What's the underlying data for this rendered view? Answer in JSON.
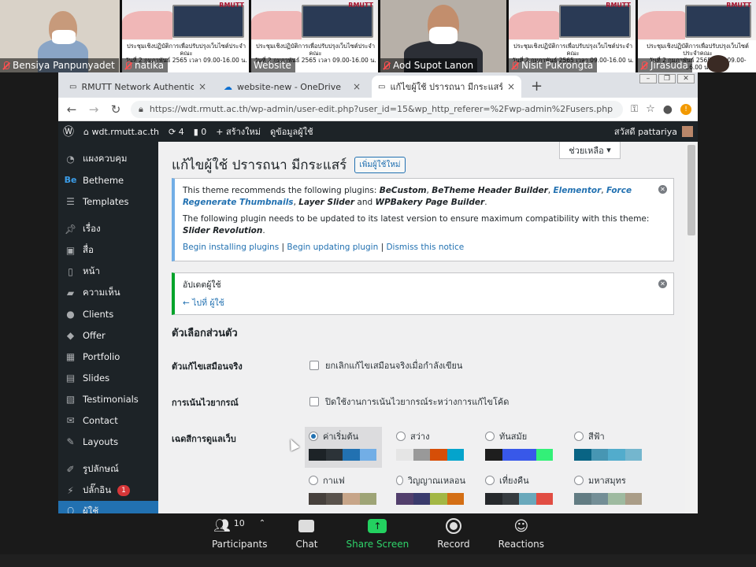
{
  "participants": [
    {
      "name": "Bensiya Panpunyadet",
      "muted": true
    },
    {
      "name": "natika",
      "muted": true
    },
    {
      "name": "Website",
      "muted": false
    },
    {
      "name": "Aod Supot Lanon",
      "muted": true
    },
    {
      "name": "Nisit Pukrongta",
      "muted": true
    },
    {
      "name": "Jirasuda",
      "muted": true
    }
  ],
  "slide": {
    "logo": "RMUTT",
    "caption_line1": "ประชุมเชิงปฏิบัติการเพื่อปรับปรุงเว็บไซต์ประจำคณะ",
    "caption_line2": "วันที่ 2 กุมภาพันธ์ 2565 เวลา 09.00-16.00 น."
  },
  "browser": {
    "tabs": [
      {
        "label": "RMUTT Network Authentication",
        "active": false
      },
      {
        "label": "website-new - OneDrive",
        "active": false
      },
      {
        "label": "แก้ไขผู้ใช้ ปรารถนา มีกระแสร์ ‹ wdt.",
        "active": true
      }
    ],
    "url": "https://wdt.rmutt.ac.th/wp-admin/user-edit.php?user_id=15&wp_http_referer=%2Fwp-admin%2Fusers.php"
  },
  "adminbar": {
    "site": "wdt.rmutt.ac.th",
    "updates": "4",
    "comments": "0",
    "new_label": "สร้างใหม่",
    "view_user": "ดูข้อมูลผู้ใช้",
    "howdy": "สวัสดี pattariya"
  },
  "sidebar": {
    "items": [
      {
        "label": "แผงควบคุม",
        "icon": "dashboard-icon"
      },
      {
        "label": "Betheme",
        "icon": "betheme-icon"
      },
      {
        "label": "Templates",
        "icon": "templates-icon"
      },
      {
        "label": "เรื่อง",
        "icon": "pin-icon"
      },
      {
        "label": "สื่อ",
        "icon": "media-icon"
      },
      {
        "label": "หน้า",
        "icon": "page-icon"
      },
      {
        "label": "ความเห็น",
        "icon": "comment-icon"
      },
      {
        "label": "Clients",
        "icon": "clients-icon"
      },
      {
        "label": "Offer",
        "icon": "offer-icon"
      },
      {
        "label": "Portfolio",
        "icon": "portfolio-icon"
      },
      {
        "label": "Slides",
        "icon": "slides-icon"
      },
      {
        "label": "Testimonials",
        "icon": "testimonials-icon"
      },
      {
        "label": "Contact",
        "icon": "contact-icon"
      },
      {
        "label": "Layouts",
        "icon": "layouts-icon"
      },
      {
        "label": "รูปลักษณ์",
        "icon": "appearance-icon"
      },
      {
        "label": "ปลั๊กอิน",
        "icon": "plugins-icon",
        "badge": "1"
      },
      {
        "label": "ผู้ใช้",
        "icon": "users-icon"
      }
    ]
  },
  "content": {
    "help": "ช่วยเหลือ",
    "title": "แก้ไขผู้ใช้ ปรารถนา มีกระแสร์",
    "add_new": "เพิ่มผู้ใช้ใหม่",
    "notice1": {
      "pre": "This theme recommends the following plugins: ",
      "p1": "BeCustom",
      "p2": "BeTheme Header Builder",
      "p3": "Elementor",
      "p4": "Force Regenerate Thumbnails",
      "p5": "Layer Slider",
      "and": " and ",
      "p6": "WPBakery Page Builder",
      "line2": "The following plugin needs to be updated to its latest version to ensure maximum compatibility with this theme: ",
      "p7": "Slider Revolution",
      "link1": "Begin installing plugins",
      "link2": "Begin updating plugin",
      "link3": "Dismiss this notice"
    },
    "notice2": {
      "text": "อัปเดตผู้ใช้",
      "link": "← ไปที่ ผู้ใช้"
    },
    "section_title": "ตัวเลือกส่วนตัว",
    "visual_editor_label": "ตัวแก้ไขเสมือนจริง",
    "visual_editor_option": "ยกเลิกแก้ไขเสมือนจริงเมื่อกำลังเขียน",
    "syntax_label": "การเน้นไวยากรณ์",
    "syntax_option": "ปิดใช้งานการเน้นไวยากรณ์ระหว่างการแก้ไขโค้ด",
    "color_scheme_label": "เฉดสีการดูแลเว็บ",
    "schemes": [
      {
        "name": "ค่าเริ่มต้น",
        "selected": true,
        "colors": [
          "#1d2327",
          "#2c3338",
          "#2271b1",
          "#72aee6"
        ]
      },
      {
        "name": "สว่าง",
        "selected": false,
        "colors": [
          "#e5e5e5",
          "#999999",
          "#d64e07",
          "#04a4cc"
        ]
      },
      {
        "name": "ทันสมัย",
        "selected": false,
        "colors": [
          "#1e1e1e",
          "#3858e9",
          "#3858e9",
          "#33f078"
        ]
      },
      {
        "name": "สีฟ้า",
        "selected": false,
        "colors": [
          "#096484",
          "#4796b3",
          "#52accc",
          "#74b6ce"
        ]
      },
      {
        "name": "กาแฟ",
        "selected": false,
        "colors": [
          "#46403c",
          "#59524c",
          "#c7a589",
          "#9ea476"
        ]
      },
      {
        "name": "วิญญาณเหลอน",
        "selected": false,
        "colors": [
          "#523f6d",
          "#3a3b6d",
          "#a3b745",
          "#d46f15"
        ]
      },
      {
        "name": "เที่ยงคืน",
        "selected": false,
        "colors": [
          "#25282b",
          "#363b3f",
          "#69a8bb",
          "#e14d43"
        ]
      },
      {
        "name": "มหาสมุทร",
        "selected": false,
        "colors": [
          "#627c83",
          "#738e96",
          "#9ebaa0",
          "#aa9d88"
        ]
      }
    ]
  },
  "zoom": {
    "participants_label": "Participants",
    "participants_count": "10",
    "chat_label": "Chat",
    "share_label": "Share Screen",
    "record_label": "Record",
    "reactions_label": "Reactions"
  }
}
